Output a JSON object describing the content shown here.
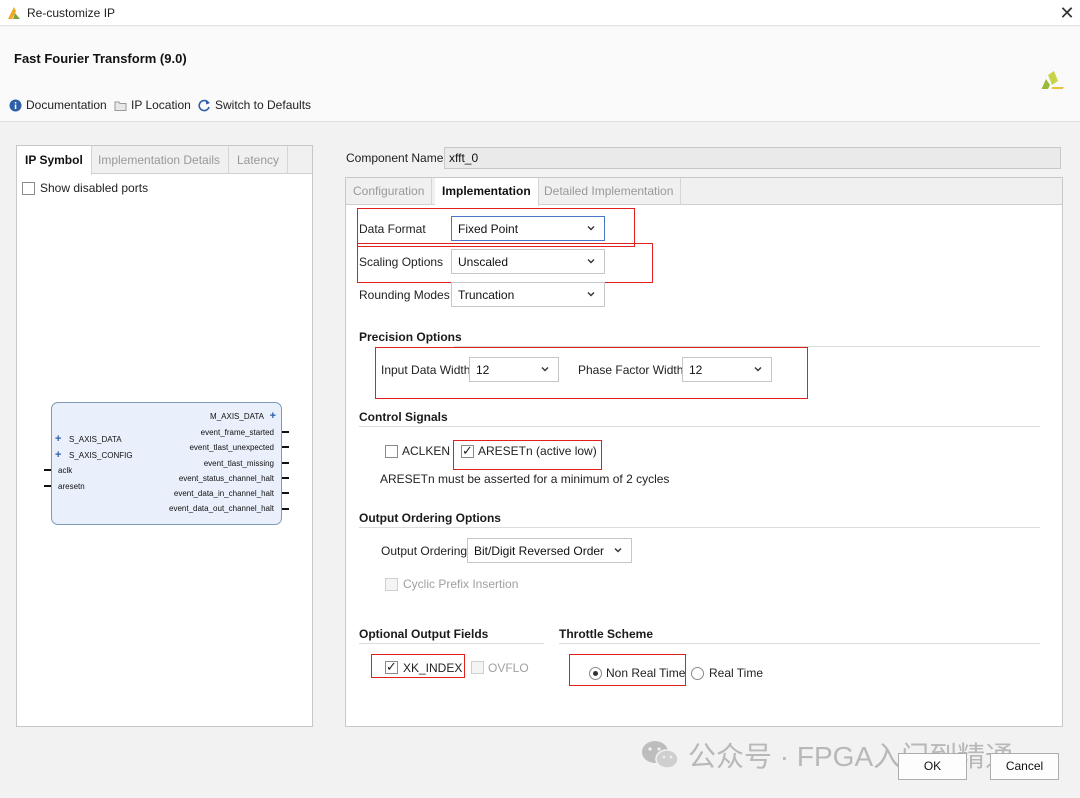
{
  "window": {
    "title": "Re-customize IP",
    "close_glyph": "✕"
  },
  "header": {
    "title": "Fast Fourier Transform (9.0)"
  },
  "toolbar": {
    "documentation": "Documentation",
    "ip_location": "IP Location",
    "switch_defaults": "Switch to Defaults"
  },
  "left": {
    "tabs": [
      "IP Symbol",
      "Implementation Details",
      "Latency"
    ],
    "show_disabled_ports": "Show disabled ports",
    "ip_symbol": {
      "left_ports": [
        "S_AXIS_DATA",
        "S_AXIS_CONFIG",
        "aclk",
        "aresetn"
      ],
      "right_ports": [
        "M_AXIS_DATA",
        "event_frame_started",
        "event_tlast_unexpected",
        "event_tlast_missing",
        "event_status_channel_halt",
        "event_data_in_channel_halt",
        "event_data_out_channel_halt"
      ]
    }
  },
  "right": {
    "component_name_label": "Component Name",
    "component_name_value": "xfft_0",
    "tabs": [
      "Configuration",
      "Implementation",
      "Detailed Implementation"
    ],
    "data_format": {
      "label": "Data Format",
      "value": "Fixed Point"
    },
    "scaling_options": {
      "label": "Scaling Options",
      "value": "Unscaled"
    },
    "rounding_modes": {
      "label": "Rounding Modes",
      "value": "Truncation"
    },
    "precision_options": {
      "title": "Precision Options",
      "input_width_label": "Input Data Width",
      "input_width_value": "12",
      "phase_width_label": "Phase Factor Width",
      "phase_width_value": "12"
    },
    "control_signals": {
      "title": "Control Signals",
      "aclken": "ACLKEN",
      "aresetn": "ARESETn (active low)",
      "note": "ARESETn must be asserted for a minimum of 2 cycles"
    },
    "output_ordering": {
      "title": "Output Ordering Options",
      "label": "Output Ordering",
      "value": "Bit/Digit Reversed Order",
      "cyclic_prefix": "Cyclic Prefix Insertion"
    },
    "optional_output": {
      "title": "Optional Output Fields",
      "xk_index": "XK_INDEX",
      "ovflo": "OVFLO"
    },
    "throttle": {
      "title": "Throttle Scheme",
      "non_real_time": "Non Real Time",
      "real_time": "Real Time"
    }
  },
  "buttons": {
    "ok": "OK",
    "cancel": "Cancel"
  },
  "watermark": {
    "text": "公众号 · FPGA入门到精通"
  },
  "colors": {
    "highlight_box": "#e0201c",
    "accent": "#4a78c6",
    "ip_block_fill": "#e9f0fb"
  }
}
